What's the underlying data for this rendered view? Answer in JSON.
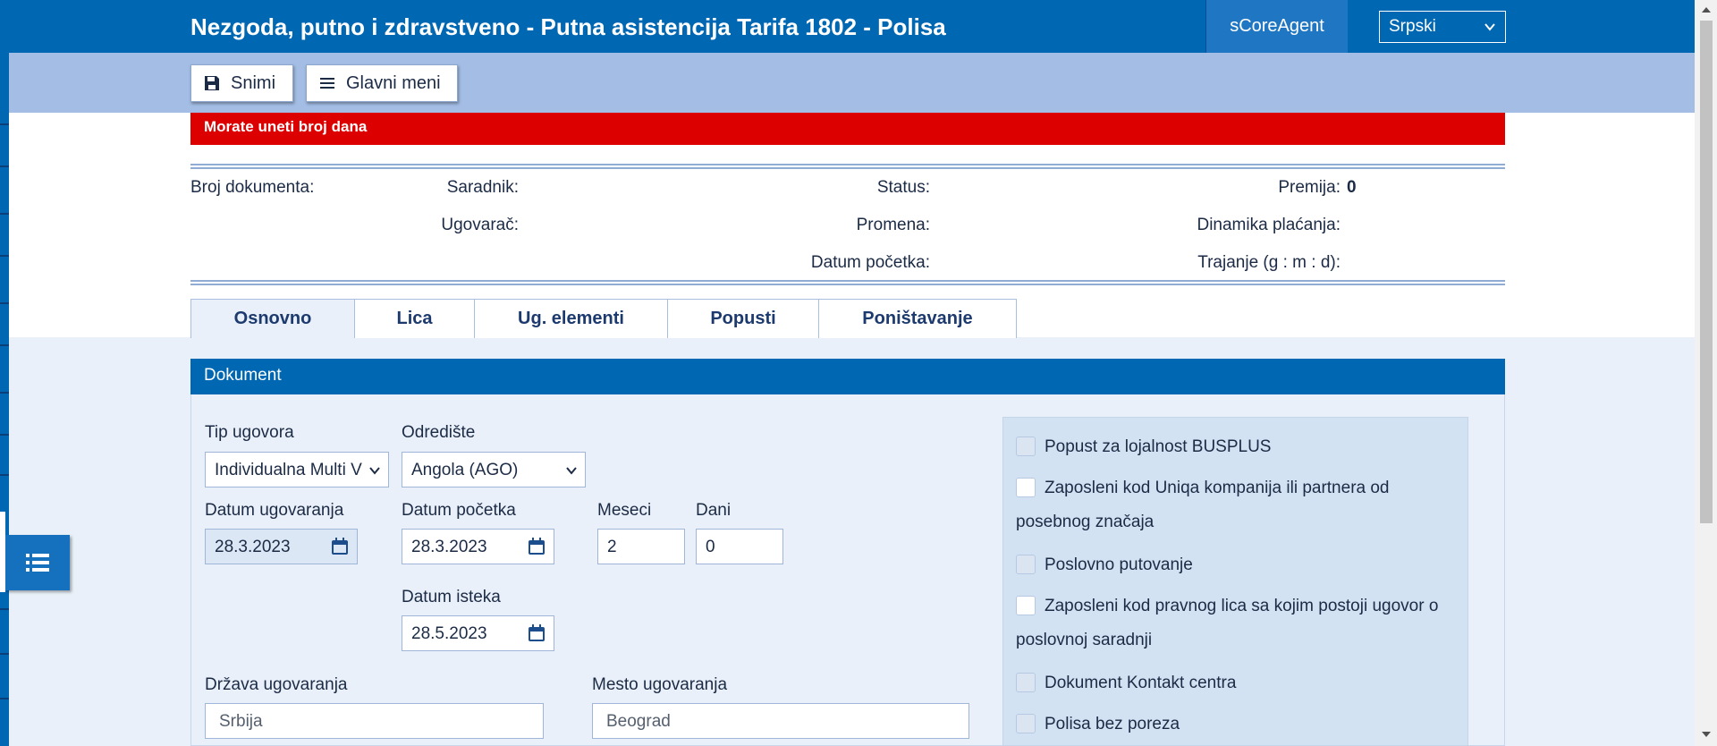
{
  "header": {
    "title": "Nezgoda, putno i zdravstveno - Putna asistencija Tarifa 1802 - Polisa",
    "agent_label": "sCoreAgent",
    "language": "Srpski"
  },
  "toolbar": {
    "save_label": "Snimi",
    "main_menu_label": "Glavni meni"
  },
  "alert": {
    "message": "Morate uneti broj dana"
  },
  "summary": {
    "document_number_label": "Broj dokumenta:",
    "associate_label": "Saradnik:",
    "status_label": "Status:",
    "premium_label": "Premija:",
    "premium_value": "0",
    "contractor_label": "Ugovarač:",
    "change_label": "Promena:",
    "payment_dynamics_label": "Dinamika plaćanja:",
    "start_date_label": "Datum početka:",
    "duration_label": "Trajanje (g : m : d):"
  },
  "tabs": [
    {
      "label": "Osnovno",
      "active": true
    },
    {
      "label": "Lica",
      "active": false
    },
    {
      "label": "Ug. elementi",
      "active": false
    },
    {
      "label": "Popusti",
      "active": false
    },
    {
      "label": "Poništavanje",
      "active": false
    }
  ],
  "document": {
    "section_title": "Dokument",
    "contract_type": {
      "label": "Tip ugovora",
      "value": "Individualna Multi V"
    },
    "destination": {
      "label": "Odredište",
      "value": "Angola (AGO)"
    },
    "contract_date": {
      "label": "Datum ugovaranja",
      "value": "28.3.2023"
    },
    "start_date": {
      "label": "Datum početka",
      "value": "28.3.2023"
    },
    "months": {
      "label": "Meseci",
      "value": "2"
    },
    "days": {
      "label": "Dani",
      "value": "0"
    },
    "expiry_date": {
      "label": "Datum isteka",
      "value": "28.5.2023"
    },
    "contract_country": {
      "label": "Država ugovaranja",
      "value": "Srbija"
    },
    "contract_place": {
      "label": "Mesto ugovaranja",
      "value": "Beograd"
    }
  },
  "options": [
    {
      "label": "Popust za lojalnost BUSPLUS",
      "enabled": false
    },
    {
      "label": "Zaposleni kod Uniqa kompanija ili partnera od posebnog značaja",
      "enabled": true
    },
    {
      "label": "Poslovno putovanje",
      "enabled": false
    },
    {
      "label": "Zaposleni kod pravnog lica sa kojim postoji ugovor o poslovnoj saradnji",
      "enabled": true
    },
    {
      "label": "Dokument Kontakt centra",
      "enabled": false
    },
    {
      "label": "Polisa bez poreza",
      "enabled": false
    }
  ],
  "icons": {
    "save": "floppy-disk-icon",
    "menu": "hamburger-icon",
    "calendar": "calendar-icon",
    "side_menu": "list-icon",
    "chevron": "chevron-down-icon"
  },
  "colors": {
    "primary": "#0067b3",
    "toolbar": "#a3bde4",
    "alert": "#dd0000",
    "panel": "#e9f0f9"
  }
}
